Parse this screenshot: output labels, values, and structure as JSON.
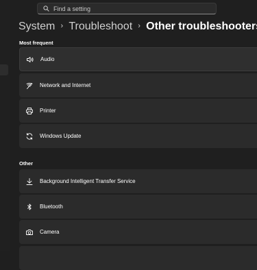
{
  "search": {
    "placeholder": "Find a setting",
    "icon": "search-icon"
  },
  "breadcrumb": {
    "items": [
      "System",
      "Troubleshoot",
      "Other troubleshooters"
    ],
    "separator": "›"
  },
  "sections": {
    "most_frequent": {
      "heading": "Most frequent",
      "items": [
        {
          "label": "Audio",
          "icon": "speaker-icon"
        },
        {
          "label": "Network and Internet",
          "icon": "network-icon"
        },
        {
          "label": "Printer",
          "icon": "printer-icon"
        },
        {
          "label": "Windows Update",
          "icon": "sync-icon"
        }
      ]
    },
    "other": {
      "heading": "Other",
      "items": [
        {
          "label": "Background Intelligent Transfer Service",
          "icon": "download-icon"
        },
        {
          "label": "Bluetooth",
          "icon": "bluetooth-icon"
        },
        {
          "label": "Camera",
          "icon": "camera-icon"
        }
      ]
    }
  },
  "colors": {
    "background": "#1f1f1f",
    "card": "#2b2b2b",
    "text": "#ffffff"
  }
}
